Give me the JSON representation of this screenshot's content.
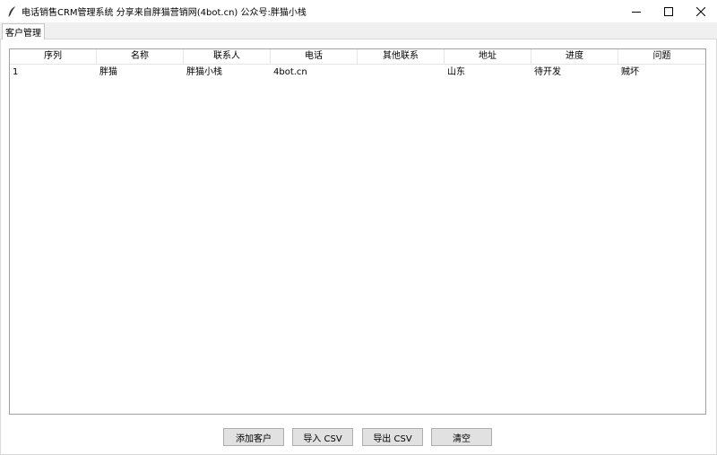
{
  "window": {
    "title": "电话销售CRM管理系统  分享来自胖猫营销网(4bot.cn) 公众号:胖猫小栈",
    "app_icon": "feather-icon",
    "controls": [
      "minimize-icon",
      "maximize-icon",
      "close-icon"
    ]
  },
  "tabs": [
    {
      "label": "客户管理",
      "active": true
    }
  ],
  "table": {
    "columns": [
      "序列",
      "名称",
      "联系人",
      "电话",
      "其他联系",
      "地址",
      "进度",
      "问题"
    ],
    "rows": [
      [
        "1",
        "胖猫",
        "胖猫小栈",
        "4bot.cn",
        "",
        "山东",
        "待开发",
        "贼坏"
      ]
    ]
  },
  "buttons": {
    "add": "添加客户",
    "import": "导入 CSV",
    "export": "导出 CSV",
    "clear": "清空"
  }
}
